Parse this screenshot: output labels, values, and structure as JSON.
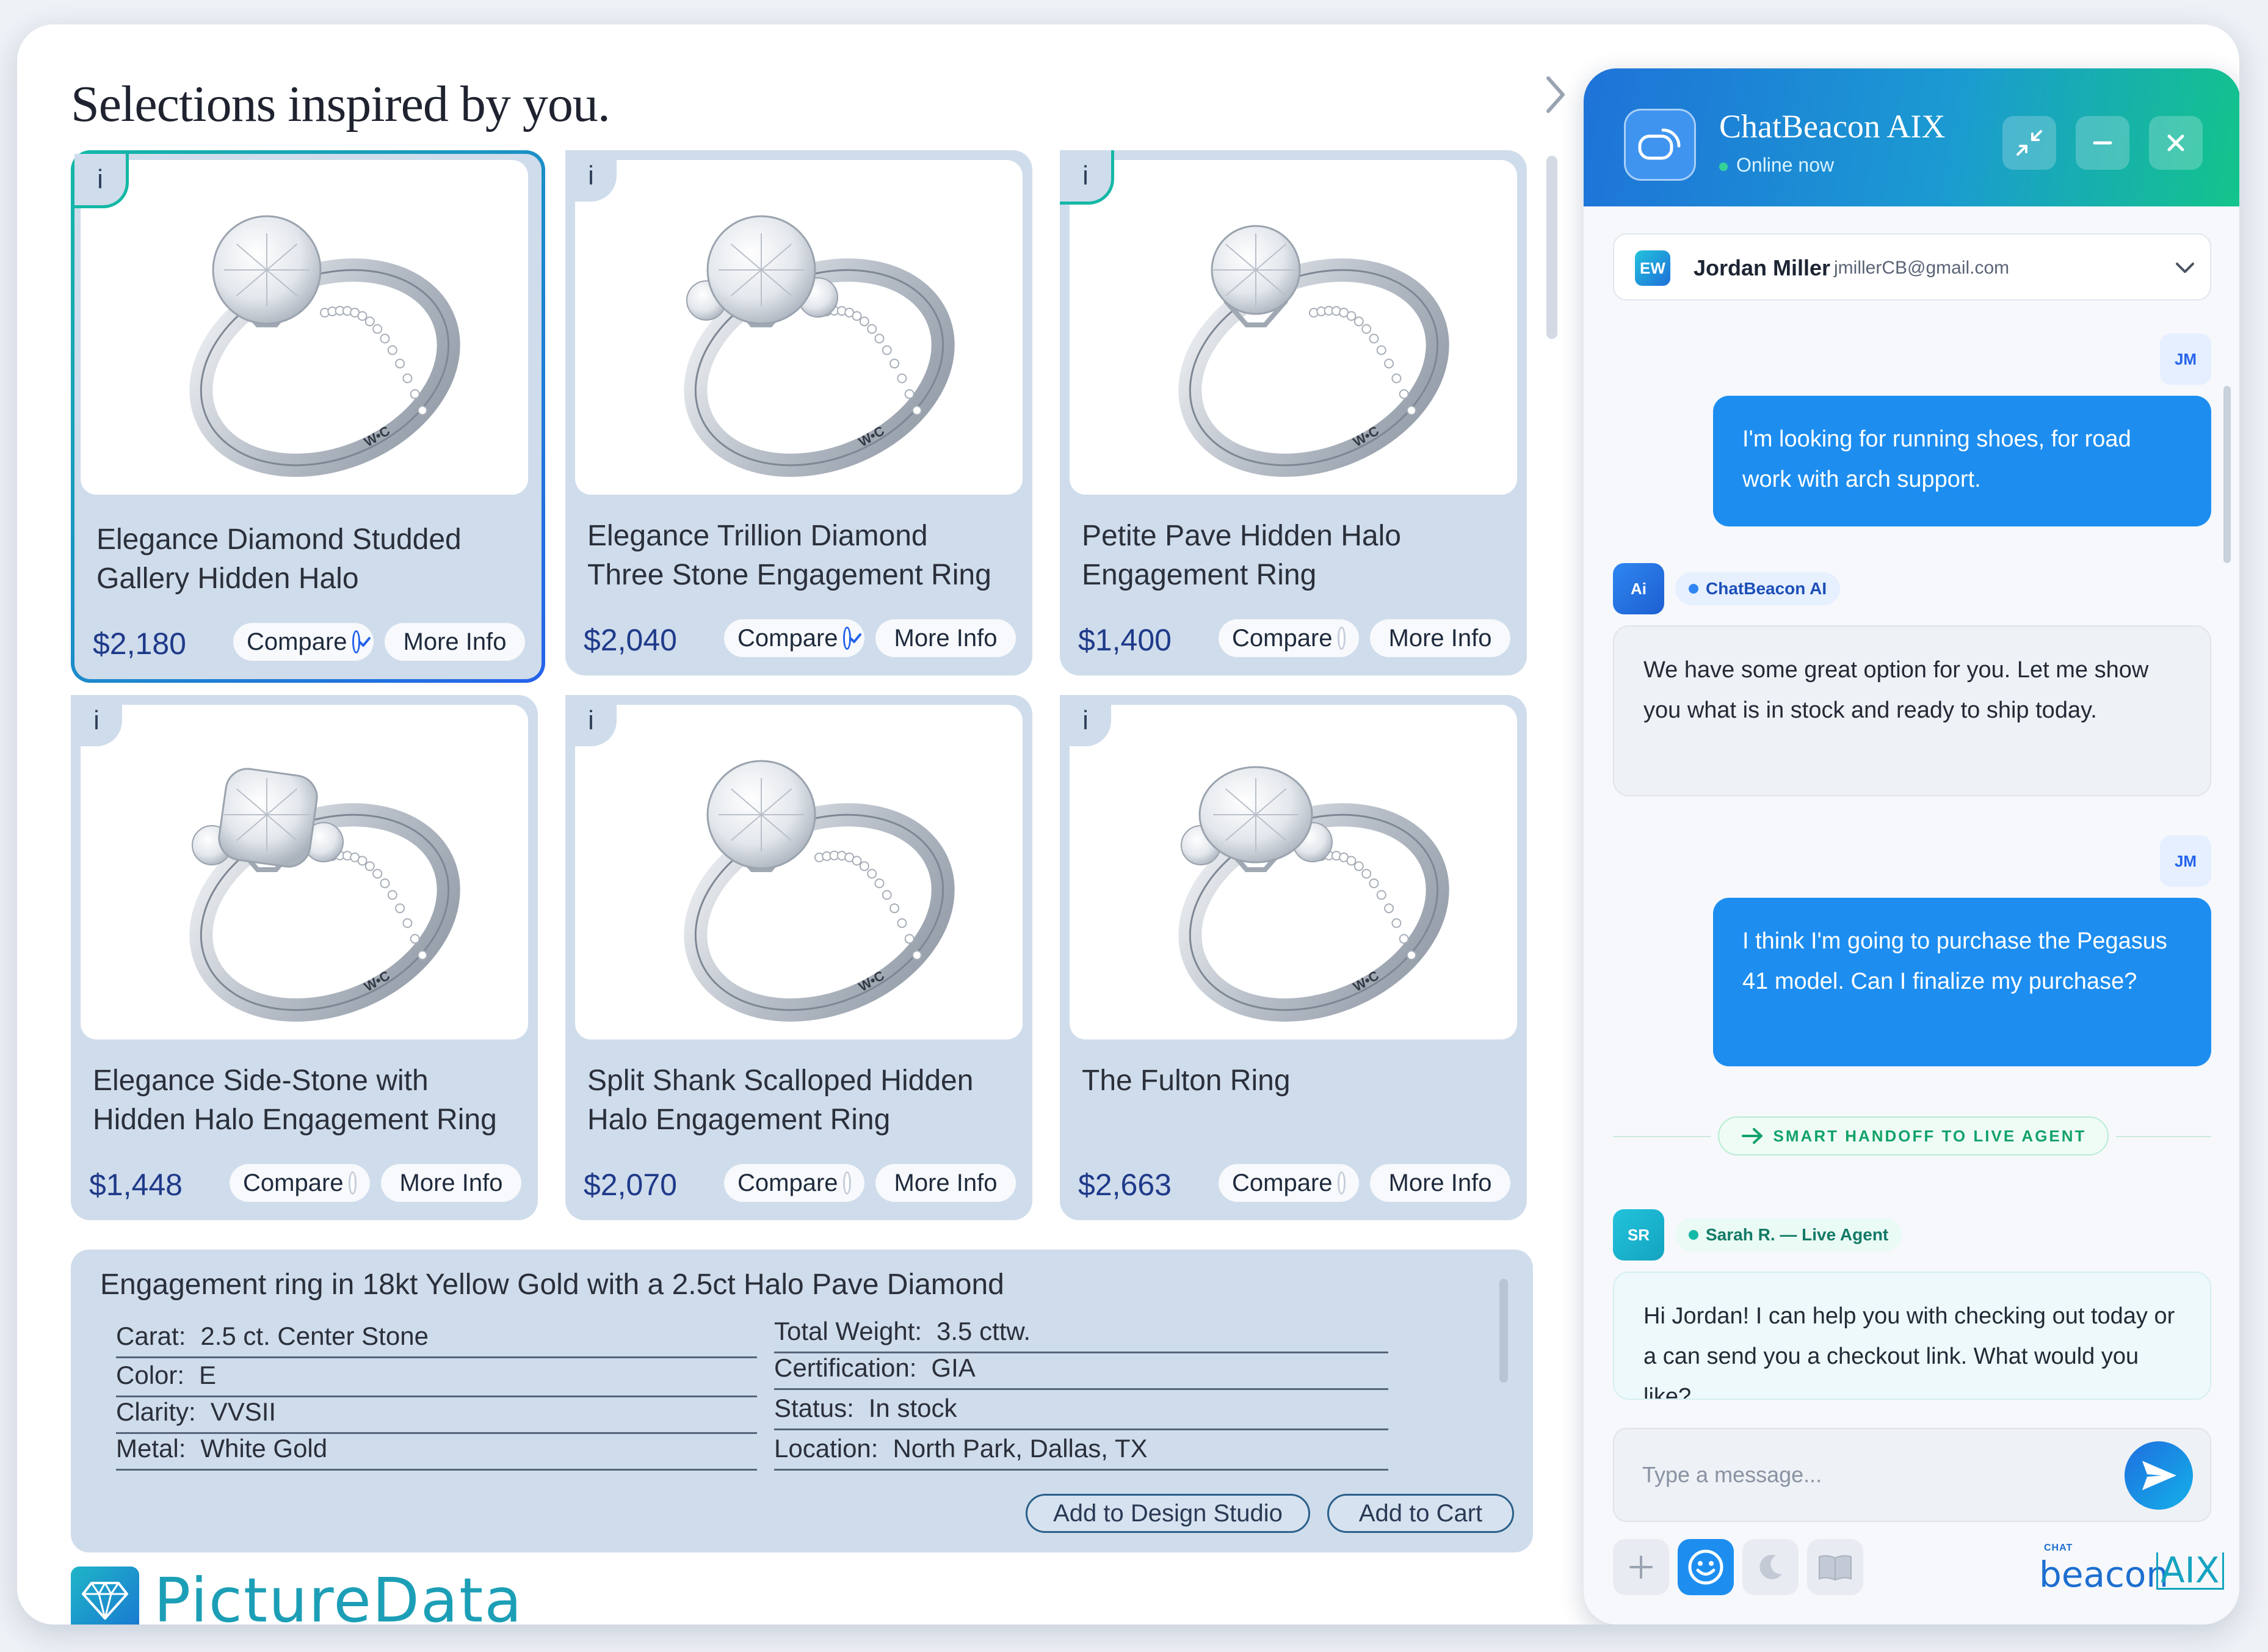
{
  "heading": "Selections inspired by you.",
  "products": [
    {
      "title_lines": [
        "Elegance Diamond Studded",
        "Gallery Hidden Halo"
      ],
      "price": "$2,180",
      "compare_label": "Compare",
      "compare_checked": true,
      "more_label": "More Info",
      "info": "i",
      "selected": true,
      "variant": "pave"
    },
    {
      "title_lines": [
        "Elegance Trillion Diamond",
        "Three Stone Engagement Ring"
      ],
      "price": "$2,040",
      "compare_label": "Compare",
      "compare_checked": true,
      "more_label": "More Info",
      "info": "i",
      "selected": false,
      "variant": "halo"
    },
    {
      "title_lines": [
        "Petite Pave Hidden Halo",
        "Engagement Ring"
      ],
      "price": "$1,400",
      "compare_label": "Compare",
      "compare_checked": false,
      "more_label": "More Info",
      "info": "i",
      "selected": false,
      "variant": "solitaire"
    },
    {
      "title_lines": [
        "Elegance Side-Stone with",
        "Hidden Halo Engagement Ring"
      ],
      "price": "$1,448",
      "compare_label": "Compare",
      "compare_checked": false,
      "more_label": "More Info",
      "info": "i",
      "selected": false,
      "variant": "cushion"
    },
    {
      "title_lines": [
        "Split Shank Scalloped Hidden",
        "Halo Engagement Ring"
      ],
      "price": "$2,070",
      "compare_label": "Compare",
      "compare_checked": false,
      "more_label": "More Info",
      "info": "i",
      "selected": false,
      "variant": "split"
    },
    {
      "title_lines": [
        "The Fulton Ring",
        ""
      ],
      "price": "$2,663",
      "compare_label": "Compare",
      "compare_checked": false,
      "more_label": "More Info",
      "info": "i",
      "selected": false,
      "variant": "oval"
    }
  ],
  "ring_engraving": "W•C",
  "detail": {
    "title": "Engagement ring in 18kt Yellow Gold with a 2.5ct Halo Pave Diamond",
    "specs_left": [
      {
        "k": "Carat:",
        "v": "2.5 ct. Center Stone"
      },
      {
        "k": "Color:",
        "v": "E"
      },
      {
        "k": "Clarity:",
        "v": "VVSII"
      },
      {
        "k": "Metal:",
        "v": "White Gold"
      }
    ],
    "specs_right": [
      {
        "k": "Total Weight:",
        "v": "3.5 cttw."
      },
      {
        "k": "Certification:",
        "v": "GIA"
      },
      {
        "k": "Status:",
        "v": "In stock"
      },
      {
        "k": "Location:",
        "v": "North Park, Dallas, TX"
      }
    ],
    "design_studio_label": "Add to Design Studio",
    "cart_label": "Add to Cart"
  },
  "logo_text": "PictureData",
  "chat": {
    "title": "ChatBeacon AIX",
    "status": "Online now",
    "user": {
      "initials": "EW",
      "name": "Jordan Miller",
      "email": "jmillerCB@gmail.com"
    },
    "messages": [
      {
        "role": "user",
        "avatar": "JM",
        "text": "I'm looking for running shoes, for road work with arch support."
      },
      {
        "role": "ai",
        "avatar": "Ai",
        "sender": "ChatBeacon AI",
        "text": "We have some great option for you. Let me show you what is in stock and ready to ship today."
      },
      {
        "role": "user",
        "avatar": "JM",
        "text": "I think I'm going to purchase the Pegasus 41 model. Can I finalize my purchase?"
      },
      {
        "role": "agent",
        "avatar": "SR",
        "sender": "Sarah R. — Live Agent",
        "text": "Hi Jordan! I can help you with checking out today or a can send you a checkout link. What would you like?"
      }
    ],
    "handoff_label": "SMART HANDOFF TO LIVE AGENT",
    "input_placeholder": "Type a message...",
    "brand_small": "CHAT",
    "brand_main": "beacon",
    "brand_aix": "AIX",
    "colors": {
      "accent": "#1d8ef0",
      "online": "#34d399",
      "handoff": "#12a269"
    }
  }
}
